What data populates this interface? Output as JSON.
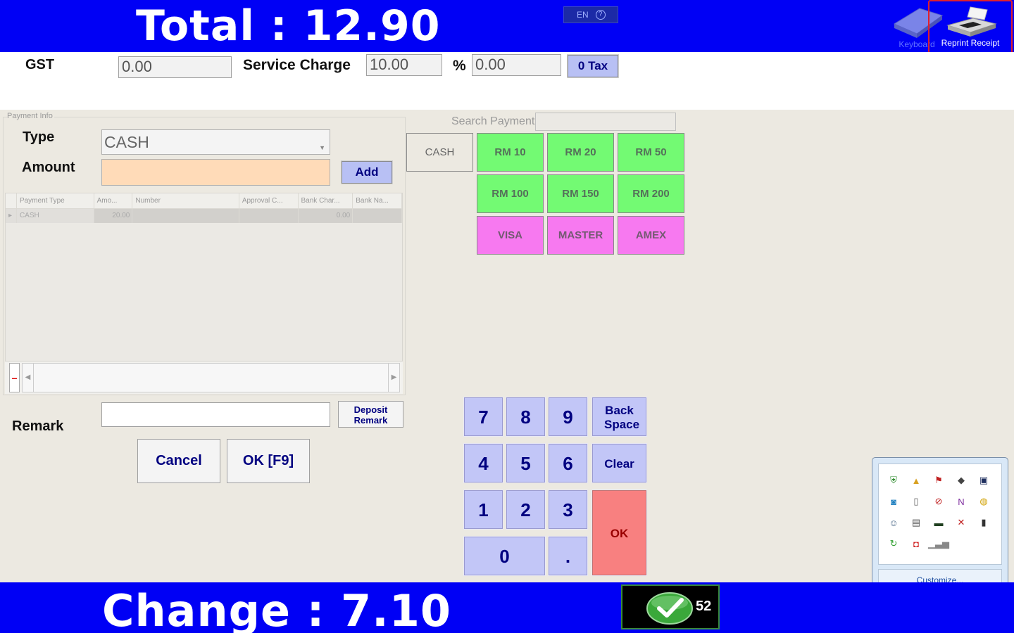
{
  "header": {
    "total_text": "Total :  12.90",
    "language": "EN",
    "help_glyph": "?",
    "keyboard_label": "Keyboard",
    "reprint_label": "Reprint Receipt"
  },
  "tax": {
    "gst_label": "GST",
    "gst_value": "0.00",
    "service_label": "Service Charge",
    "service_value": "10.00",
    "percent_label": "%",
    "percent_value": "0.00",
    "zero_tax_label": "0 Tax"
  },
  "payment_info": {
    "group_title": "Payment Info",
    "type_label": "Type",
    "type_value": "CASH",
    "amount_label": "Amount",
    "amount_value": "",
    "add_label": "Add",
    "columns": [
      "Payment Type",
      "Amo...",
      "Number",
      "Approval C...",
      "Bank Char...",
      "Bank Na..."
    ],
    "rows": [
      {
        "type": "CASH",
        "amount": "20.00",
        "number": "",
        "approval": "",
        "bank_charge": "0.00",
        "bank_name": ""
      }
    ],
    "remove_label": "–",
    "remark_label": "Remark",
    "remark_value": "",
    "deposit_remark_label": "Deposit Remark",
    "cancel_label": "Cancel",
    "ok_f9_label": "OK [F9]"
  },
  "payment_methods": {
    "search_label": "Search Payment",
    "search_value": "",
    "cash": "CASH",
    "rm": [
      "RM 10",
      "RM 20",
      "RM 50",
      "RM 100",
      "RM 150",
      "RM 200"
    ],
    "cards": [
      "VISA",
      "MASTER",
      "AMEX"
    ]
  },
  "keypad": {
    "digits": [
      "7",
      "8",
      "9",
      "4",
      "5",
      "6",
      "1",
      "2",
      "3"
    ],
    "zero": "0",
    "dot": ".",
    "backspace": "Back Space",
    "clear": "Clear",
    "ok": "OK"
  },
  "tray": {
    "customize_label": "Customize...",
    "icons": [
      "shield-check-icon",
      "cloud-drive-icon",
      "flag-error-icon",
      "diamond-icon",
      "monitor-icon",
      "network-icon",
      "battery-icon",
      "volume-muted-icon",
      "onenote-icon",
      "globe-icon",
      "user-icon",
      "printer-icon",
      "display-icon",
      "antivirus-icon",
      "usb-icon",
      "sync-icon",
      "red-app-icon",
      "signal-bars-icon"
    ]
  },
  "footer": {
    "change_text": "Change :  7.10",
    "status_count": "52"
  },
  "colors": {
    "bar_blue": "#0000f5",
    "rm_green": "#73fa73",
    "card_pink": "#f779f0",
    "key_blue": "#c2c6f7",
    "ok_red": "#f88080",
    "amount_peach": "#ffdbb8"
  }
}
